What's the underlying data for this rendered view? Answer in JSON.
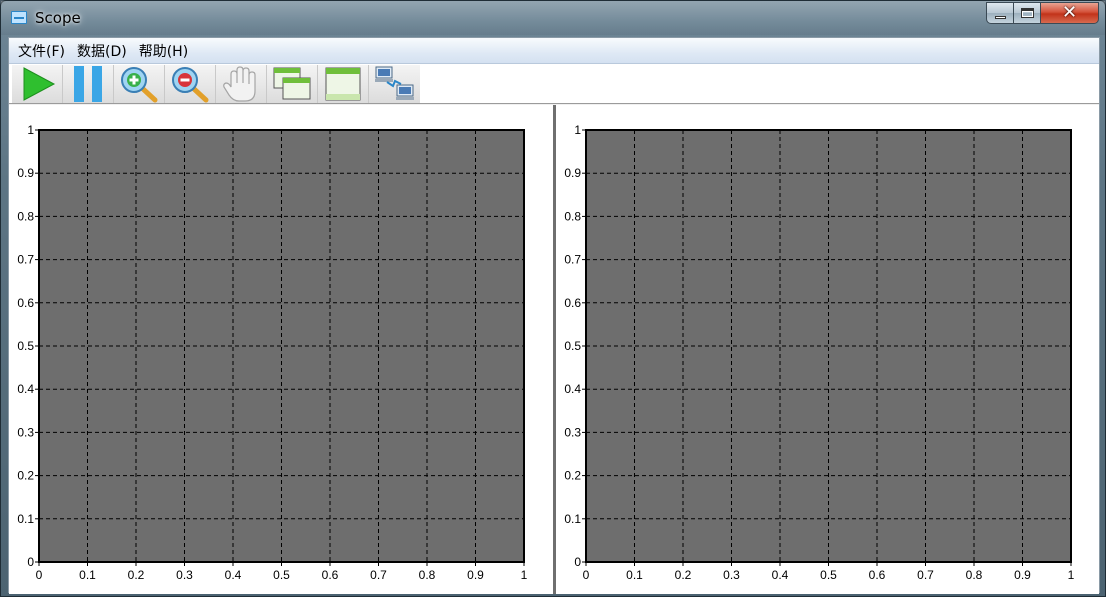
{
  "window": {
    "title": "Scope"
  },
  "menu": {
    "items": [
      {
        "label": "文件(F)"
      },
      {
        "label": "数据(D)"
      },
      {
        "label": "帮助(H)"
      }
    ]
  },
  "toolbar": {
    "buttons": [
      {
        "icon": "play-icon"
      },
      {
        "icon": "pause-icon"
      },
      {
        "icon": "zoom-in-icon"
      },
      {
        "icon": "zoom-out-icon"
      },
      {
        "icon": "hand-pan-icon"
      },
      {
        "icon": "multi-window-icon"
      },
      {
        "icon": "single-window-icon"
      },
      {
        "icon": "network-computers-icon"
      }
    ]
  },
  "colors": {
    "plot_bg": "#6e6e6e",
    "grid": "#000000",
    "play": "#2fbf2f",
    "pause": "#3aa6e6"
  },
  "chart_data": [
    {
      "type": "line",
      "title": "",
      "xlabel": "",
      "ylabel": "",
      "xlim": [
        0,
        1
      ],
      "ylim": [
        0,
        1
      ],
      "x_ticks": [
        "0",
        "0.1",
        "0.2",
        "0.3",
        "0.4",
        "0.5",
        "0.6",
        "0.7",
        "0.8",
        "0.9",
        "1"
      ],
      "y_ticks": [
        "0",
        "0.1",
        "0.2",
        "0.3",
        "0.4",
        "0.5",
        "0.6",
        "0.7",
        "0.8",
        "0.9",
        "1"
      ],
      "grid": true,
      "series": []
    },
    {
      "type": "line",
      "title": "",
      "xlabel": "",
      "ylabel": "",
      "xlim": [
        0,
        1
      ],
      "ylim": [
        0,
        1
      ],
      "x_ticks": [
        "0",
        "0.1",
        "0.2",
        "0.3",
        "0.4",
        "0.5",
        "0.6",
        "0.7",
        "0.8",
        "0.9",
        "1"
      ],
      "y_ticks": [
        "0",
        "0.1",
        "0.2",
        "0.3",
        "0.4",
        "0.5",
        "0.6",
        "0.7",
        "0.8",
        "0.9",
        "1"
      ],
      "grid": true,
      "series": []
    }
  ]
}
